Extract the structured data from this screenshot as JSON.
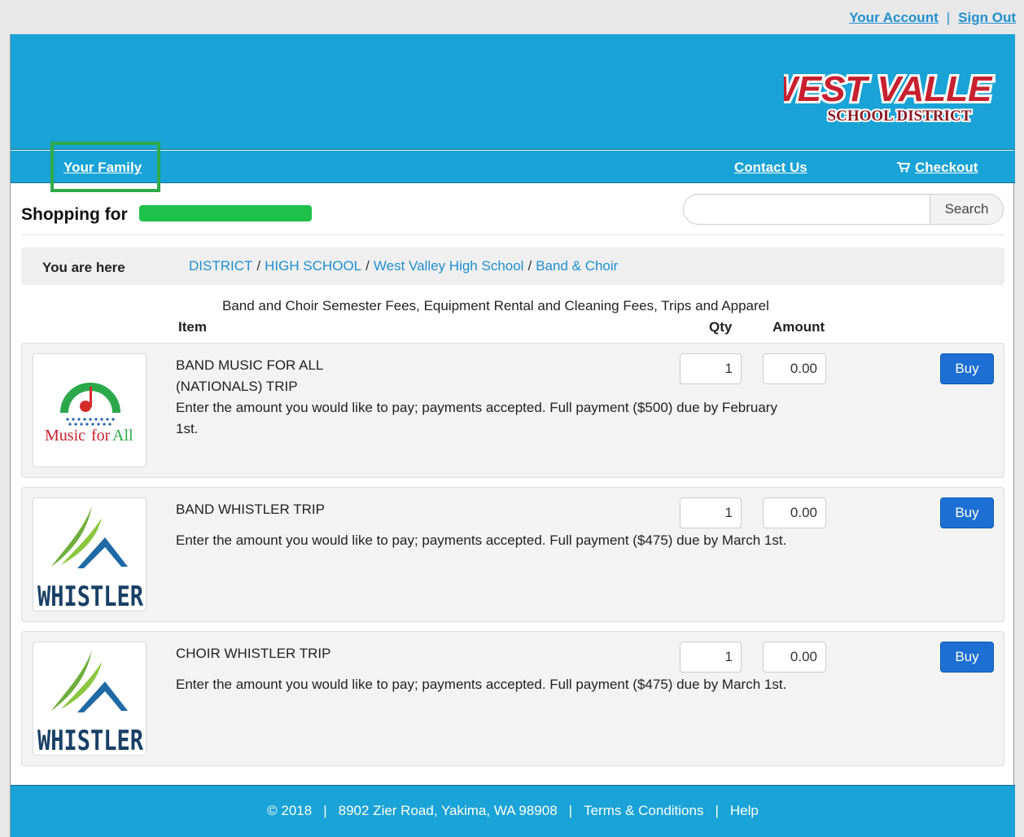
{
  "top": {
    "account_label": "Your Account",
    "separator": "|",
    "signout_label": "Sign Out"
  },
  "brand": {
    "logo_line1": "WEST VALLEY",
    "logo_line2": "SCHOOL DISTRICT",
    "logo_color": "#c8202f"
  },
  "nav": {
    "family_label": "Your Family",
    "contact_label": "Contact Us",
    "checkout_label": "Checkout"
  },
  "shop": {
    "title": "Shopping for"
  },
  "search": {
    "value": "",
    "button_label": "Search"
  },
  "breadcrumb": {
    "label": "You are here",
    "items": [
      "DISTRICT",
      "HIGH SCHOOL",
      "West Valley High School",
      "Band & Choir"
    ],
    "separator": "/"
  },
  "section": {
    "title": "Band and Choir Semester Fees, Equipment Rental and Cleaning Fees, Trips and Apparel",
    "col_item": "Item",
    "col_qty": "Qty",
    "col_amount": "Amount"
  },
  "products": [
    {
      "name_line1": "BAND MUSIC FOR ALL",
      "name_line2": "(NATIONALS) TRIP",
      "desc_line1": "Enter the amount you would like to pay; payments accepted. Full payment ($500) due by February",
      "desc_line2": "1st.",
      "qty": "1",
      "amount": "0.00",
      "buy_label": "Buy",
      "logo_text1": "Music",
      "logo_text2": "for",
      "logo_text3": "All"
    },
    {
      "name_line1": "BAND WHISTLER TRIP",
      "desc_line1": "Enter the amount you would like to pay; payments accepted. Full payment ($475) due by March 1st.",
      "qty": "1",
      "amount": "0.00",
      "buy_label": "Buy",
      "logo_text": "WHISTLER"
    },
    {
      "name_line1": "CHOIR WHISTLER TRIP",
      "desc_line1": "Enter the amount you would like to pay; payments accepted. Full payment ($475) due by March 1st.",
      "qty": "1",
      "amount": "0.00",
      "buy_label": "Buy",
      "logo_text": "WHISTLER"
    }
  ],
  "footer": {
    "copyright": "© 2018",
    "sep": "|",
    "address": "8902 Zier Road, Yakima, WA 98908",
    "terms_label": "Terms & Conditions",
    "help_label": "Help"
  },
  "colors": {
    "banner": "#19a3d6",
    "link": "#1f8fcf",
    "buy": "#1d6fd4",
    "highlight": "#2eaa4a"
  }
}
